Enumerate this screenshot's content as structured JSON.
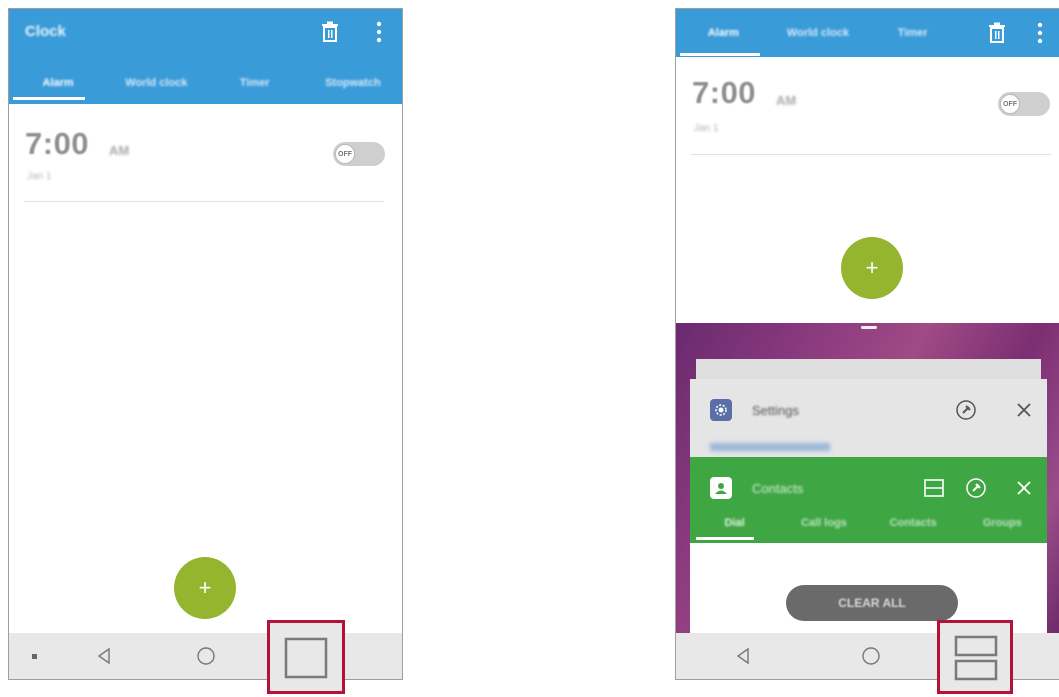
{
  "left_screen": {
    "app_title": "Clock",
    "tabs": [
      {
        "label": "Alarm",
        "active": true
      },
      {
        "label": "World clock",
        "active": false
      },
      {
        "label": "Timer",
        "active": false
      },
      {
        "label": "Stopwatch",
        "active": false
      }
    ],
    "alarm": {
      "time": "7:00",
      "ampm": "AM",
      "date": "Jan 1",
      "toggle_label": "OFF"
    },
    "fab_label": "+",
    "nav": {
      "back": "back",
      "home": "home",
      "recents": "recent-apps"
    }
  },
  "right_screen": {
    "tabs": [
      {
        "label": "Alarm",
        "active": true
      },
      {
        "label": "World clock",
        "active": false
      },
      {
        "label": "Timer",
        "active": false
      }
    ],
    "alarm": {
      "time": "7:00",
      "ampm": "AM",
      "date": "Jan 1",
      "toggle_label": "OFF"
    },
    "fab_label": "+",
    "recent_cards": [
      {
        "title": "Settings",
        "color": "#e5e5e5"
      },
      {
        "title": "Contacts",
        "color": "#3ea643"
      }
    ],
    "contacts_tabs": [
      {
        "label": "Dial",
        "active": true
      },
      {
        "label": "Call logs",
        "active": false
      },
      {
        "label": "Contacts",
        "active": false
      },
      {
        "label": "Groups",
        "active": false
      }
    ],
    "clear_all_label": "CLEAR ALL"
  },
  "colors": {
    "accent_blue": "#3a9bd9",
    "fab_green": "#95b52f",
    "highlight_red": "#b5123a",
    "contacts_green": "#3ea643"
  }
}
